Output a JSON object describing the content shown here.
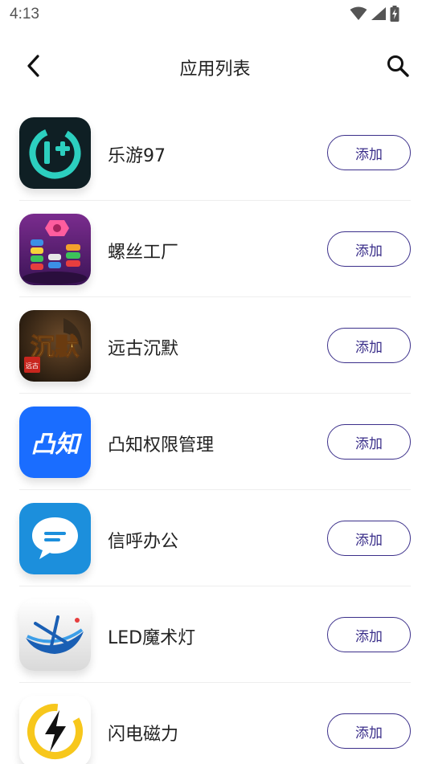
{
  "status_bar": {
    "time": "4:13",
    "icons": [
      "wifi-icon",
      "signal-icon",
      "battery-charging-icon"
    ]
  },
  "header": {
    "title": "应用列表",
    "back_icon": "chevron-left-icon",
    "search_icon": "search-icon"
  },
  "apps": [
    {
      "name": "乐游97",
      "action_label": "添加",
      "icon": "leyou97-app-icon"
    },
    {
      "name": "螺丝工厂",
      "action_label": "添加",
      "icon": "screw-factory-app-icon"
    },
    {
      "name": "远古沉默",
      "action_label": "添加",
      "icon": "ancient-silence-app-icon",
      "icon_text": "沉默",
      "icon_badge": "远古"
    },
    {
      "name": "凸知权限管理",
      "action_label": "添加",
      "icon": "tuzhi-app-icon",
      "icon_text": "凸知"
    },
    {
      "name": "信呼办公",
      "action_label": "添加",
      "icon": "xinhu-chat-app-icon"
    },
    {
      "name": "LED魔术灯",
      "action_label": "添加",
      "icon": "led-magic-light-app-icon"
    },
    {
      "name": "闪电磁力",
      "action_label": "添加",
      "icon": "lightning-magnet-app-icon"
    }
  ],
  "colors": {
    "accent": "#3b2f8a",
    "divider": "#eeeeee",
    "title_text": "#222222"
  }
}
